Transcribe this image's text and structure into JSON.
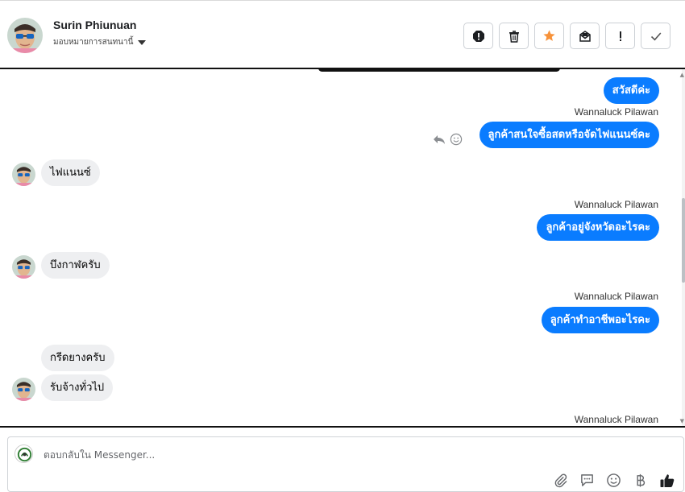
{
  "header": {
    "name": "Surin Phiunuan",
    "assign_label": "มอบหมายการสนทนานี้",
    "actions": [
      {
        "icon": "spam-alert-icon"
      },
      {
        "icon": "trash-icon"
      },
      {
        "icon": "star-icon",
        "color": "#f7923a"
      },
      {
        "icon": "mark-unread-icon"
      },
      {
        "icon": "exclamation-icon"
      },
      {
        "icon": "check-icon"
      }
    ]
  },
  "messages": [
    {
      "direction": "out",
      "text": "สวัสดีค่ะ"
    },
    {
      "sender": "Wannaluck Pilawan"
    },
    {
      "direction": "out",
      "text": "ลูกค้าสนใจซื้อสดหรือจัดไฟแนนซ์คะ"
    },
    {
      "direction": "in",
      "text": "ไฟแนนซ์"
    },
    {
      "sender": "Wannaluck Pilawan"
    },
    {
      "direction": "out",
      "text": "ลูกค้าอยู่จังหวัดอะไรคะ"
    },
    {
      "direction": "in",
      "text": "บึงกาฬครับ"
    },
    {
      "sender": "Wannaluck Pilawan"
    },
    {
      "direction": "out",
      "text": "ลูกค้าทำอาชีพอะไรคะ"
    },
    {
      "direction": "in",
      "text": "กรีดยางครับ"
    },
    {
      "direction": "in",
      "text": "รับจ้างทั่วไป"
    },
    {
      "sender": "Wannaluck Pilawan"
    }
  ],
  "composer": {
    "placeholder": "ตอบกลับใน Messenger...",
    "tools": [
      "attachment-icon",
      "saved-reply-icon",
      "emoji-icon",
      "baht-icon",
      "thumbs-up-icon"
    ]
  },
  "colors": {
    "outgoing_bubble": "#0a7cff",
    "incoming_bubble": "#eeeff1",
    "star": "#f7923a"
  }
}
